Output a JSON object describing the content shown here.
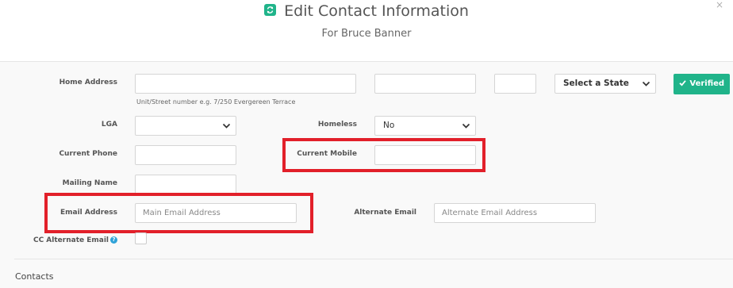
{
  "header": {
    "title": "Edit Contact Information",
    "subtitle": "For Bruce Banner",
    "title_icon": "refresh-icon",
    "close_glyph": "×",
    "accent_color": "#20b48a"
  },
  "form": {
    "home_address": {
      "label": "Home Address",
      "street_value": "",
      "suburb_value": "",
      "postcode_value": "",
      "state_selected": "Select a State",
      "help_text": "Unit/Street number e.g. 7/250 Evergereen Terrace",
      "verified_label": "Verified"
    },
    "lga": {
      "label": "LGA",
      "selected": ""
    },
    "homeless": {
      "label": "Homeless",
      "selected": "No"
    },
    "current_phone": {
      "label": "Current Phone",
      "value": ""
    },
    "current_mobile": {
      "label": "Current Mobile",
      "value": ""
    },
    "mailing_name": {
      "label": "Mailing Name",
      "value": ""
    },
    "email_address": {
      "label": "Email Address",
      "placeholder": "Main Email Address"
    },
    "alternate_email": {
      "label": "Alternate Email",
      "placeholder": "Alternate Email Address"
    },
    "cc_alternate_email": {
      "label": "CC Alternate Email",
      "checked": false,
      "info_glyph": "?"
    }
  },
  "sections": {
    "contacts_title": "Contacts"
  },
  "highlight_color": "#e2202a"
}
